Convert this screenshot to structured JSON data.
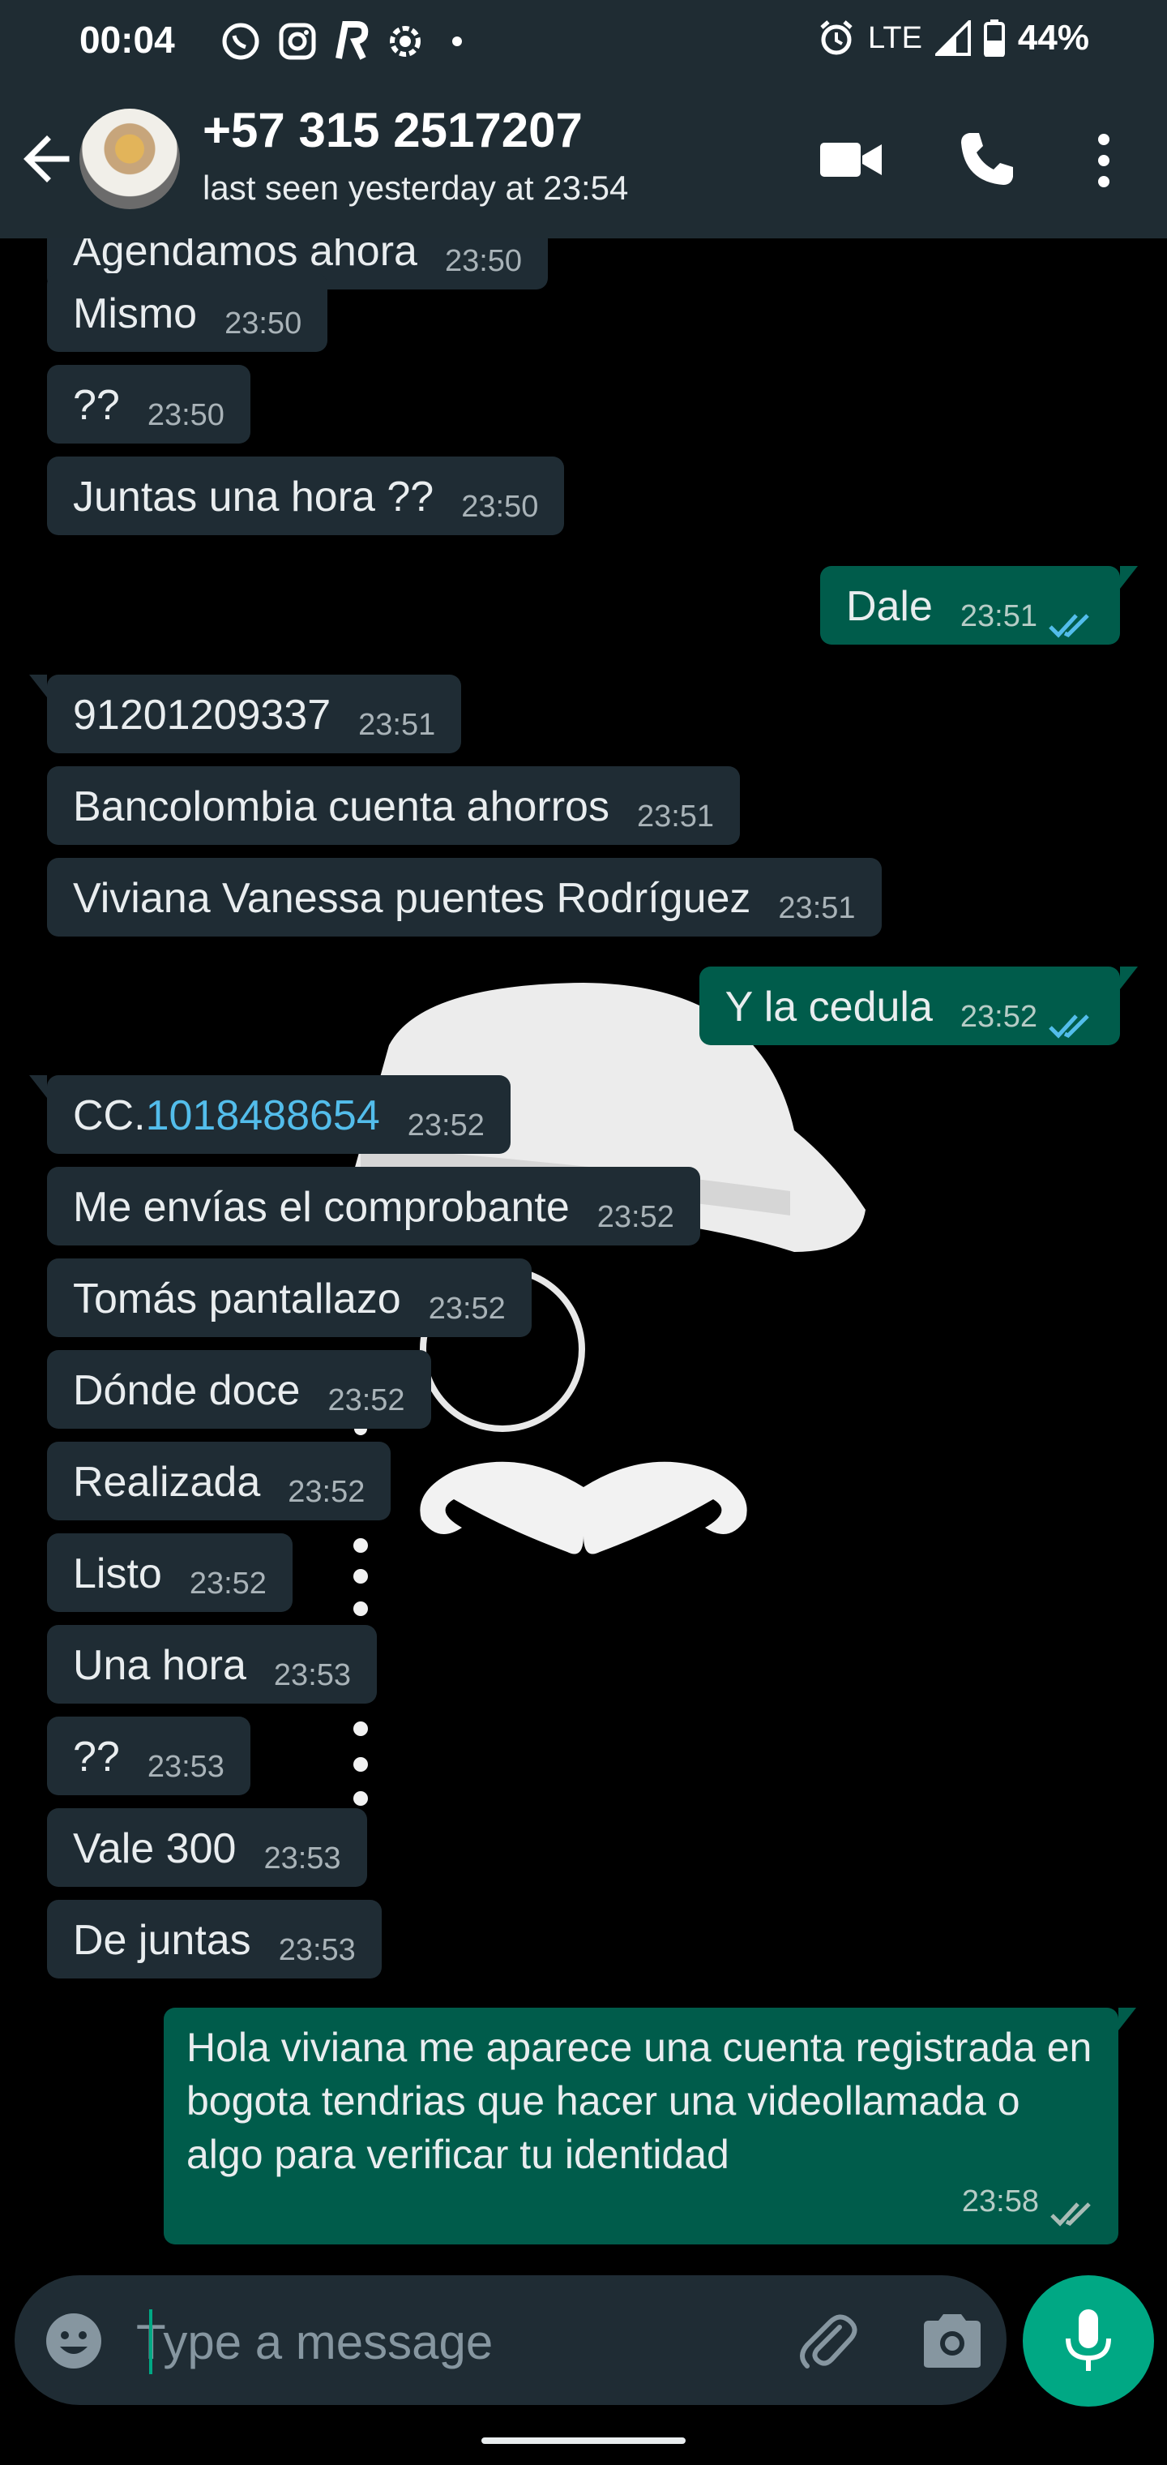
{
  "status_bar": {
    "time": "00:04",
    "network": "LTE",
    "battery": "44%",
    "icons": [
      "whatsapp-icon",
      "instagram-icon",
      "app-r-icon",
      "settings-icon",
      "dot-icon",
      "alarm-icon",
      "signal-icon",
      "battery-icon"
    ]
  },
  "header": {
    "contact_name": "+57 315 2517207",
    "last_seen": "last seen yesterday at 23:54"
  },
  "messages": [
    {
      "dir": "in",
      "text": "Agendamos ahora",
      "time": "23:50"
    },
    {
      "dir": "in",
      "text": "Mismo",
      "time": "23:50"
    },
    {
      "dir": "in",
      "text": "??",
      "time": "23:50"
    },
    {
      "dir": "in",
      "text": "Juntas una hora ??",
      "time": "23:50"
    },
    {
      "dir": "out",
      "text": "Dale",
      "time": "23:51",
      "status": "read"
    },
    {
      "dir": "in",
      "text": "91201209337",
      "time": "23:51"
    },
    {
      "dir": "in",
      "text": "Bancolombia cuenta ahorros",
      "time": "23:51"
    },
    {
      "dir": "in",
      "text": "Viviana Vanessa puentes Rodríguez",
      "time": "23:51"
    },
    {
      "dir": "out",
      "text": "Y la cedula",
      "time": "23:52",
      "status": "read"
    },
    {
      "dir": "in",
      "text_prefix": "CC.",
      "link": "1018488654",
      "time": "23:52"
    },
    {
      "dir": "in",
      "text": "Me envías el comprobante",
      "time": "23:52"
    },
    {
      "dir": "in",
      "text": "Tomás pantallazo",
      "time": "23:52"
    },
    {
      "dir": "in",
      "text": "Dónde doce",
      "time": "23:52"
    },
    {
      "dir": "in",
      "text": "Realizada",
      "time": "23:52"
    },
    {
      "dir": "in",
      "text": "Listo",
      "time": "23:52"
    },
    {
      "dir": "in",
      "text": "Una hora",
      "time": "23:53"
    },
    {
      "dir": "in",
      "text": "??",
      "time": "23:53"
    },
    {
      "dir": "in",
      "text": "Vale 300",
      "time": "23:53"
    },
    {
      "dir": "in",
      "text": "De juntas",
      "time": "23:53"
    },
    {
      "dir": "out",
      "text": "Hola viviana me aparece una cuenta registrada en bogota tendrias que hacer una videollamada o algo para verificar tu identidad",
      "time": "23:58",
      "status": "delivered"
    }
  ],
  "input": {
    "placeholder": "Type a message"
  },
  "colors": {
    "header_bg": "#1f2c33",
    "incoming_bubble": "#1f2c34",
    "outgoing_bubble": "#005c4b",
    "accent": "#00a884",
    "read_ticks": "#53bdeb",
    "link": "#53bdeb"
  }
}
